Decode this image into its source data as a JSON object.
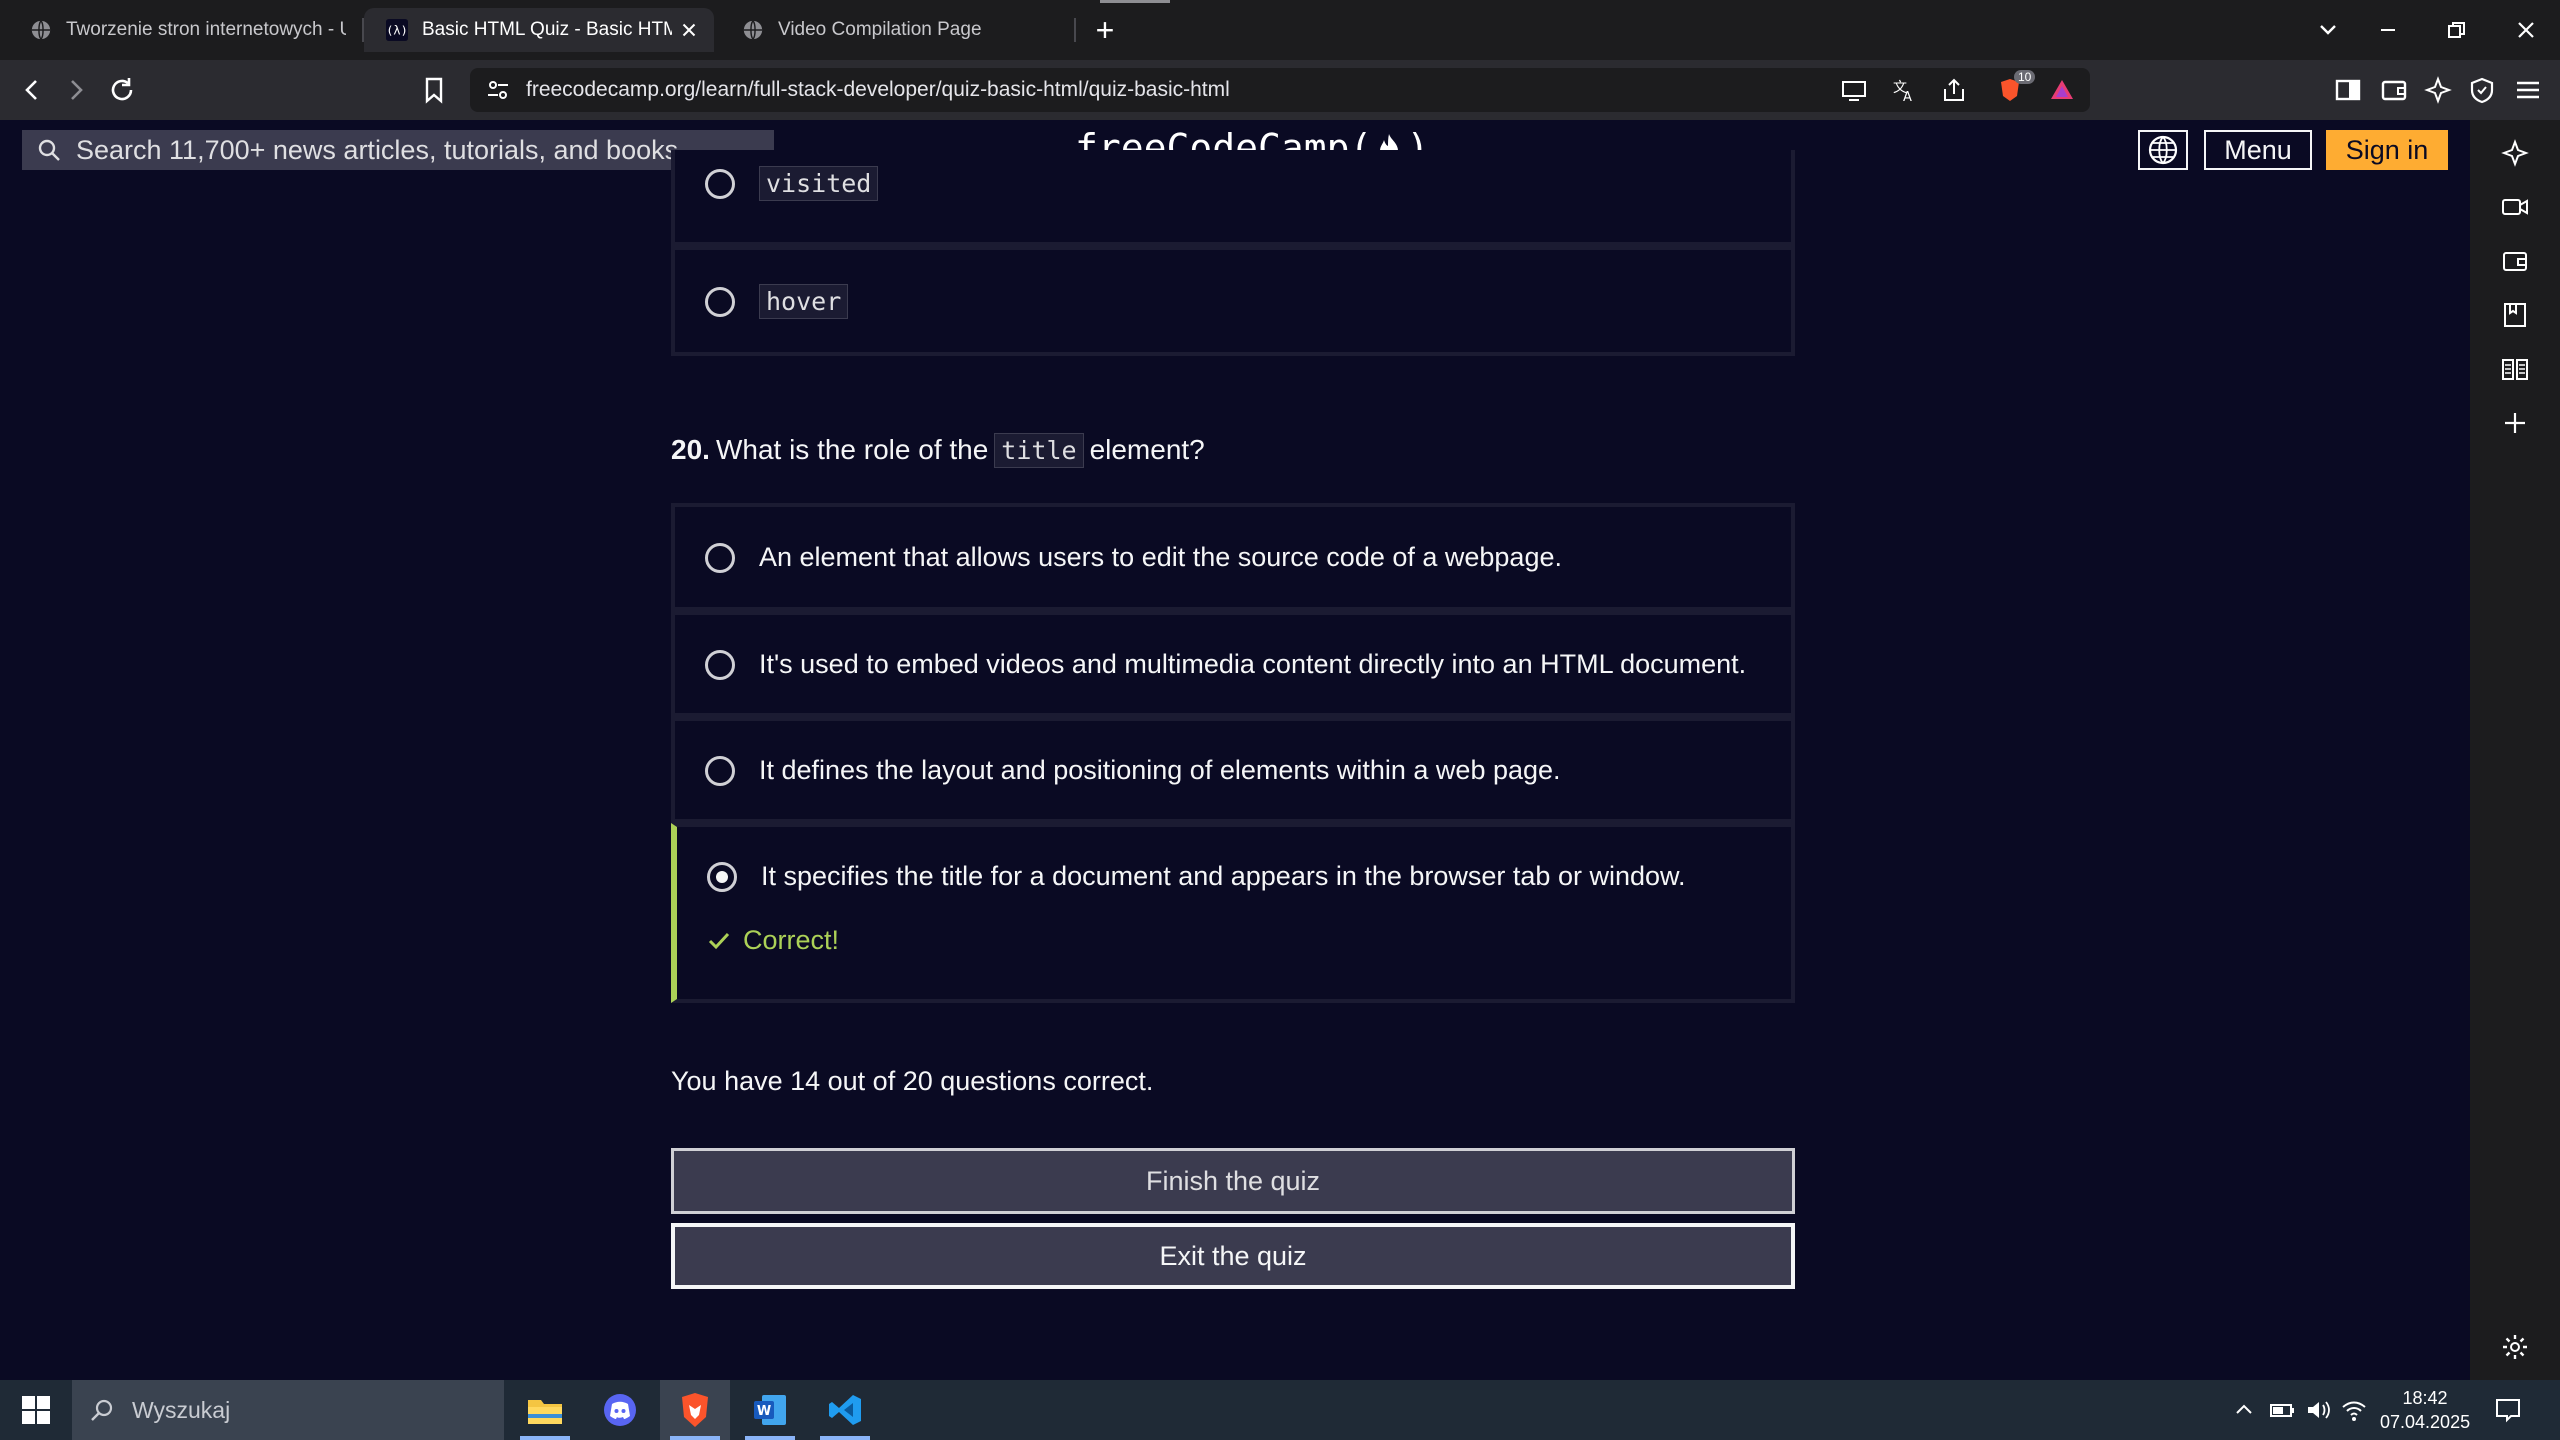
{
  "browser": {
    "tabs": [
      {
        "label": "Tworzenie stron internetowych - Un",
        "icon": "globe-icon",
        "active": false
      },
      {
        "label": "Basic HTML Quiz - Basic HTML Quiz",
        "icon": "freecodecamp-icon",
        "active": true
      },
      {
        "label": "Video Compilation Page",
        "icon": "globe-icon",
        "active": false
      }
    ],
    "new_tab": "+",
    "url": "freecodecamp.org/learn/full-stack-developer/quiz-basic-html/quiz-basic-html",
    "shield_count": "10"
  },
  "site_nav": {
    "search_placeholder": "Search 11,700+ news articles, tutorials, and books",
    "logo_text_left": "freeCodeCamp(",
    "logo_text_right": ")",
    "menu_label": "Menu",
    "signin_label": "Sign in"
  },
  "prev_question": {
    "options": [
      {
        "code": "visited",
        "selected": false
      },
      {
        "code": "hover",
        "selected": false
      }
    ]
  },
  "question20": {
    "number": "20.",
    "text_before": "What is the role of the",
    "code": "title",
    "text_after": "element?",
    "options": [
      {
        "text": "An element that allows users to edit the source code of a webpage.",
        "selected": false
      },
      {
        "text": "It's used to embed videos and multimedia content directly into an HTML document.",
        "selected": false
      },
      {
        "text": "It defines the layout and positioning of elements within a web page.",
        "selected": false
      },
      {
        "text": "It specifies the title for a document and appears in the browser tab or window.",
        "selected": true
      }
    ],
    "feedback": "Correct!"
  },
  "result": {
    "score_text": "You have 14 out of 20 questions correct.",
    "correct": 14,
    "total": 20
  },
  "buttons": {
    "finish": "Finish the quiz",
    "exit": "Exit the quiz"
  },
  "taskbar": {
    "search_placeholder": "Wyszukaj",
    "apps": [
      "file-explorer-icon",
      "discord-icon",
      "brave-icon",
      "word-icon",
      "vscode-icon"
    ],
    "time": "18:42",
    "date": "07.04.2025"
  },
  "colors": {
    "page_bg": "#0a0a23",
    "option_border": "#1b1b32",
    "correct_green": "#acd157",
    "signin_yellow": "#feac32",
    "button_bg": "#3b3b4f"
  }
}
